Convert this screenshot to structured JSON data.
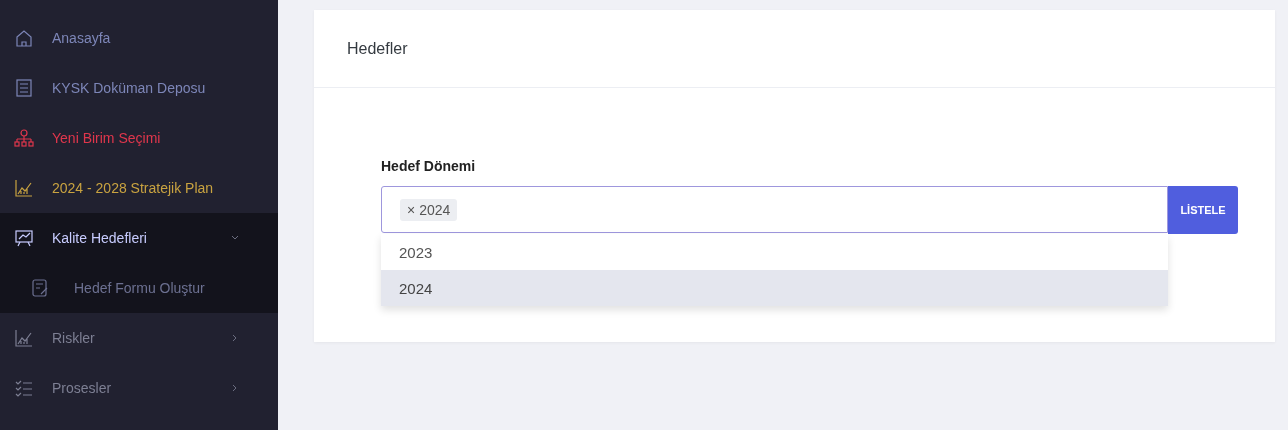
{
  "sidebar": {
    "items": [
      {
        "label": "Anasayfa",
        "color": "#7d86b8",
        "selected": false
      },
      {
        "label": "KYSK Doküman Deposu",
        "color": "#7d86b8",
        "selected": false
      },
      {
        "label": "Yeni Birim Seçimi",
        "color": "#e0364c",
        "selected": false
      },
      {
        "label": "2024 - 2028 Stratejik Plan",
        "color": "#c9a340",
        "selected": false
      },
      {
        "label": "Kalite Hedefleri",
        "color": "#c8ccff",
        "selected": true,
        "expanded": true,
        "children": [
          {
            "label": "Hedef Formu Oluştur",
            "selected": false
          }
        ]
      },
      {
        "label": "Riskler",
        "color": "#7d7f93",
        "selected": false,
        "expanded": false
      },
      {
        "label": "Prosesler",
        "color": "#7d7f93",
        "selected": false,
        "expanded": false
      }
    ]
  },
  "card": {
    "title": "Hedefler",
    "field": {
      "label": "Hedef Dönemi",
      "tags": [
        {
          "remove": "×",
          "label": "2024"
        }
      ],
      "button": "LİSTELE",
      "options": [
        {
          "label": "2023",
          "selected": false
        },
        {
          "label": "2024",
          "selected": true
        }
      ]
    }
  }
}
